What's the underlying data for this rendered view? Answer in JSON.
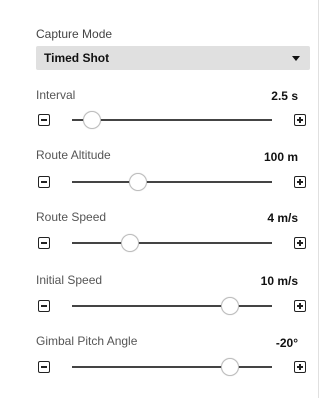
{
  "capture_mode": {
    "label": "Capture Mode",
    "selected": "Timed Shot"
  },
  "sliders": [
    {
      "label": "Interval",
      "value": "2.5 s",
      "position": 0.1
    },
    {
      "label": "Route Altitude",
      "value": "100 m",
      "position": 0.33
    },
    {
      "label": "Route Speed",
      "value": "4 m/s",
      "position": 0.29
    },
    {
      "label": "Initial Speed",
      "value": "10 m/s",
      "position": 0.79
    },
    {
      "label": "Gimbal Pitch Angle",
      "value": "-20°",
      "position": 0.79
    }
  ],
  "icons": {
    "decrease": "minus-square-icon",
    "increase": "plus-square-icon",
    "dropdown": "chevron-down-icon"
  }
}
